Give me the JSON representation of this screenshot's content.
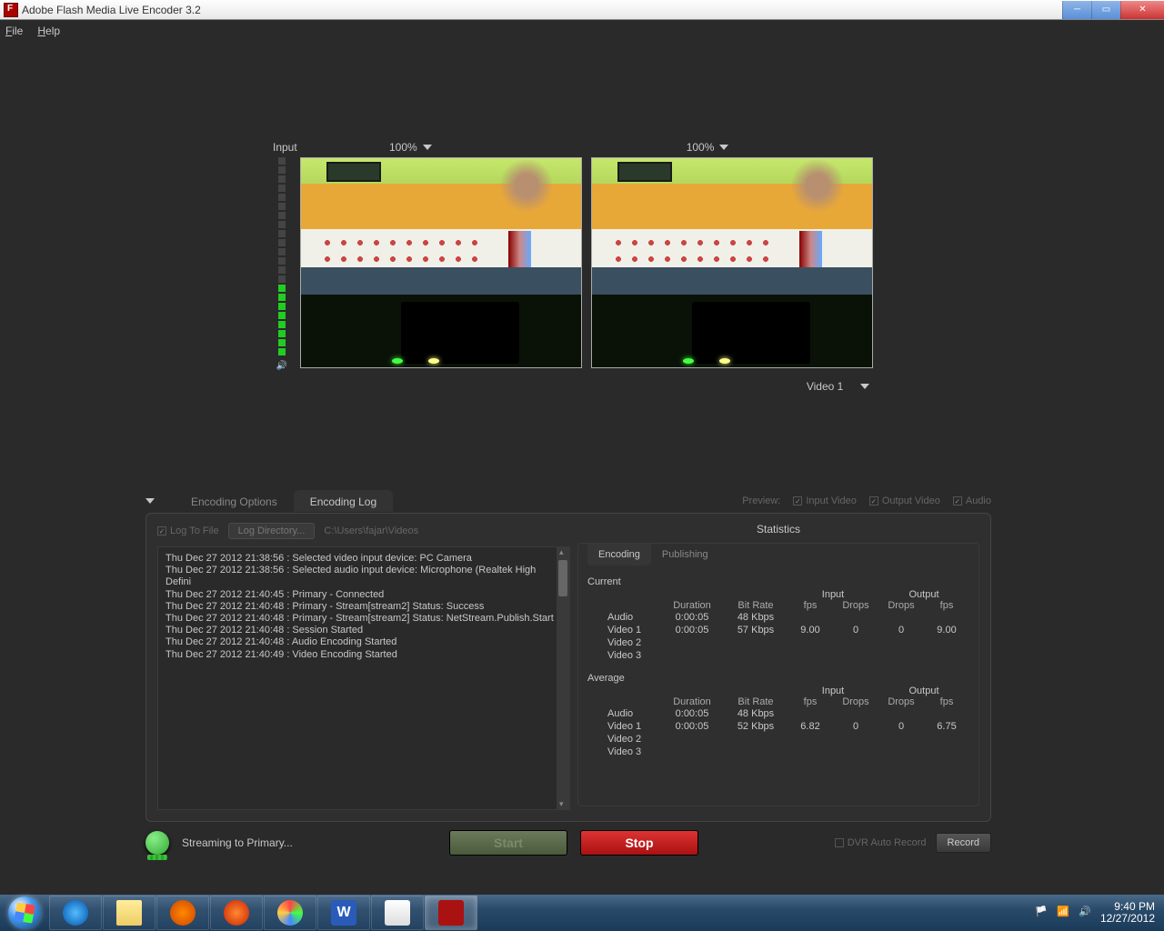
{
  "window": {
    "title": "Adobe Flash Media Live Encoder 3.2"
  },
  "menu": {
    "file": "File",
    "help": "Help"
  },
  "preview": {
    "input_label": "Input",
    "input_zoom": "100%",
    "output_zoom": "100%",
    "output_select": "Video 1"
  },
  "tabs": {
    "options_label": "Encoding Options",
    "log_label": "Encoding Log",
    "preview_label": "Preview:",
    "chk_input": "Input Video",
    "chk_output": "Output Video",
    "chk_audio": "Audio"
  },
  "log": {
    "log_to_file": "Log To File",
    "log_dir_btn": "Log Directory...",
    "log_path": "C:\\Users\\fajar\\Videos",
    "lines": [
      "Thu Dec 27 2012 21:38:56 : Selected video input device: PC Camera",
      "Thu Dec 27 2012 21:38:56 : Selected audio input device: Microphone (Realtek High Defini",
      "Thu Dec 27 2012 21:40:45 : Primary - Connected",
      "Thu Dec 27 2012 21:40:48 : Primary - Stream[stream2] Status: Success",
      "Thu Dec 27 2012 21:40:48 : Primary - Stream[stream2] Status: NetStream.Publish.Start",
      "Thu Dec 27 2012 21:40:48 : Session Started",
      "Thu Dec 27 2012 21:40:48 : Audio Encoding Started",
      "Thu Dec 27 2012 21:40:49 : Video Encoding Started"
    ]
  },
  "stats": {
    "title": "Statistics",
    "tab_encoding": "Encoding",
    "tab_publishing": "Publishing",
    "current_label": "Current",
    "average_label": "Average",
    "hdr_duration": "Duration",
    "hdr_bitrate": "Bit Rate",
    "hdr_input": "Input",
    "hdr_output": "Output",
    "hdr_fps": "fps",
    "hdr_drops": "Drops",
    "row_audio": "Audio",
    "row_v1": "Video 1",
    "row_v2": "Video 2",
    "row_v3": "Video 3",
    "current": {
      "audio": {
        "dur": "0:00:05",
        "br": "48 Kbps",
        "ifps": "",
        "idrops": "",
        "odrops": "",
        "ofps": ""
      },
      "v1": {
        "dur": "0:00:05",
        "br": "57 Kbps",
        "ifps": "9.00",
        "idrops": "0",
        "odrops": "0",
        "ofps": "9.00"
      }
    },
    "average": {
      "audio": {
        "dur": "0:00:05",
        "br": "48 Kbps",
        "ifps": "",
        "idrops": "",
        "odrops": "",
        "ofps": ""
      },
      "v1": {
        "dur": "0:00:05",
        "br": "52 Kbps",
        "ifps": "6.82",
        "idrops": "0",
        "odrops": "0",
        "ofps": "6.75"
      }
    }
  },
  "controls": {
    "status": "Streaming to Primary...",
    "start": "Start",
    "stop": "Stop",
    "dvr": "DVR Auto Record",
    "record": "Record"
  },
  "tray": {
    "time": "9:40 PM",
    "date": "12/27/2012"
  }
}
